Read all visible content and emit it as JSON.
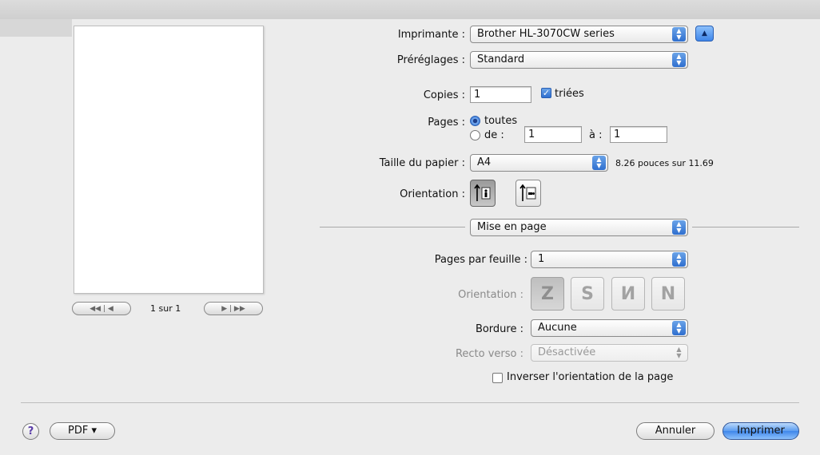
{
  "preview": {
    "page_indicator": "1 sur 1",
    "first_prev": "◀◀ | ◀",
    "next_last": "▶ | ▶▶"
  },
  "printer": {
    "label": "Imprimante :",
    "value": "Brother HL-3070CW series"
  },
  "presets": {
    "label": "Préréglages :",
    "value": "Standard"
  },
  "copies": {
    "label": "Copies :",
    "value": "1",
    "collate_label": "triées",
    "collate_checked": true
  },
  "pages": {
    "label": "Pages :",
    "all_label": "toutes",
    "from_label": "de :",
    "from_value": "1",
    "to_label": "à :",
    "to_value": "1"
  },
  "paper_size": {
    "label": "Taille du papier :",
    "value": "A4",
    "size_text": "8.26 pouces sur 11.69"
  },
  "orientation": {
    "label": "Orientation :"
  },
  "section_popup": {
    "value": "Mise en page"
  },
  "layout": {
    "pages_per_sheet_label": "Pages par feuille :",
    "pages_per_sheet_value": "1",
    "layout_direction_label": "Orientation :",
    "border_label": "Bordure :",
    "border_value": "Aucune",
    "two_sided_label": "Recto verso :",
    "two_sided_value": "Désactivée",
    "reverse_label": "Inverser l'orientation de la page"
  },
  "footer": {
    "help": "?",
    "pdf": "PDF ▾",
    "cancel": "Annuler",
    "print": "Imprimer"
  },
  "colors": {
    "accent": "#3f86ea",
    "disabled_text": "#8a8a8a"
  }
}
